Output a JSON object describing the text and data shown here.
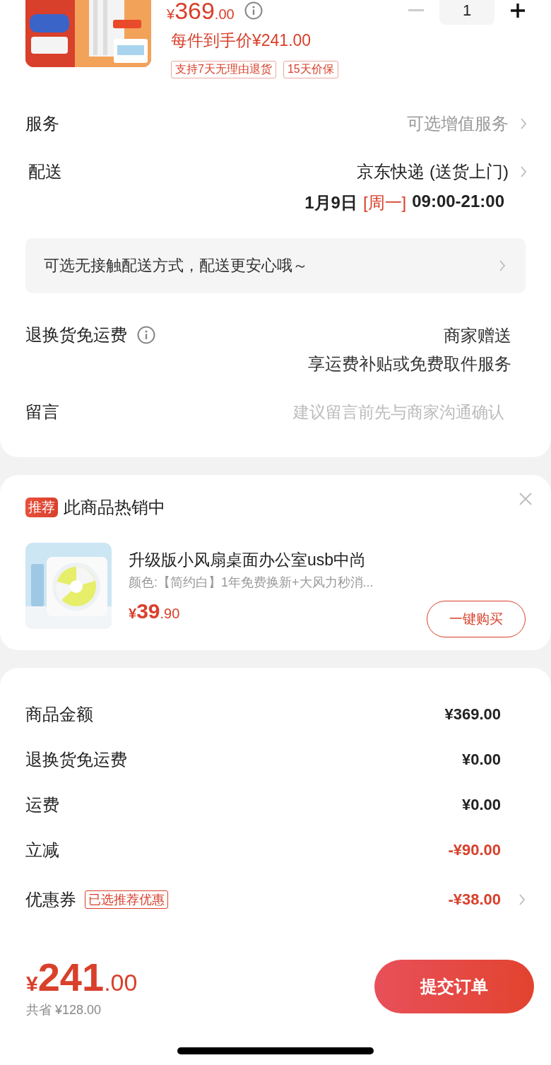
{
  "product": {
    "price_symbol": "¥",
    "price_main": "369",
    "price_decimal": ".00",
    "net_price": "每件到手价¥241.00",
    "quantity": "1",
    "tags": [
      "支持7天无理由退货",
      "15天价保"
    ]
  },
  "service": {
    "label": "服务",
    "value": "可选增值服务"
  },
  "delivery": {
    "label": "配送",
    "carrier": "京东快递 (送货上门)",
    "date": "1月9日",
    "weekday": "[周一]",
    "time": "09:00-21:00"
  },
  "contactless": {
    "text": "可选无接触配送方式，配送更安心哦～"
  },
  "return_shipping": {
    "label": "退换货免运费",
    "lines": [
      "商家赠送",
      "享运费补贴或免费取件服务"
    ]
  },
  "message": {
    "label": "留言",
    "placeholder": "建议留言前先与商家沟通确认"
  },
  "recommendation": {
    "badge": "推荐",
    "title": "此商品热销中",
    "item": {
      "name": "升级版小风扇桌面办公室usb中尚",
      "spec": "颜色:【简约白】1年免费换新+大风力秒消...",
      "price_symbol": "¥",
      "price_main": "39",
      "price_decimal": ".90",
      "button": "一键购买"
    }
  },
  "summary": [
    {
      "label": "商品金额",
      "value": "¥369.00",
      "kind": "normal",
      "has_arrow": false
    },
    {
      "label": "退换货免运费",
      "value": "¥0.00",
      "kind": "normal",
      "has_arrow": false
    },
    {
      "label": "运费",
      "value": "¥0.00",
      "kind": "normal",
      "has_arrow": false
    },
    {
      "label": "立减",
      "value": "-¥90.00",
      "kind": "discount",
      "has_arrow": false
    },
    {
      "label": "优惠券",
      "tag": "已选推荐优惠",
      "value": "-¥38.00",
      "kind": "discount",
      "has_arrow": true
    }
  ],
  "footer": {
    "price_symbol": "¥",
    "price_main": "241",
    "price_decimal": ".00",
    "saved": "共省 ¥128.00",
    "submit": "提交订单"
  }
}
